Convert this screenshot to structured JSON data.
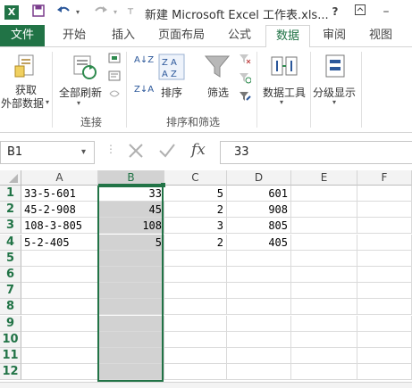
{
  "titlebar": {
    "title": "新建 Microsoft Excel 工作表.xls...",
    "help": "?",
    "app_icon": "X"
  },
  "tabs": [
    "文件",
    "开始",
    "插入",
    "页面布局",
    "公式",
    "数据",
    "审阅",
    "视图"
  ],
  "active_tab": "数据",
  "ribbon": {
    "get_external_1": "获取",
    "get_external_2": "外部数据",
    "refresh_all": "全部刷新",
    "group_connections": "连接",
    "sort": "排序",
    "filter": "筛选",
    "group_sort_filter": "排序和筛选",
    "data_tools": "数据工具",
    "outline": "分级显示",
    "sort_az": "A↓Z",
    "sort_za": "Z↓A"
  },
  "formula_bar": {
    "name_box": "B1",
    "fx": "fx",
    "value": "33"
  },
  "columns": [
    "A",
    "B",
    "C",
    "D",
    "E",
    "F"
  ],
  "selected_column": "B",
  "rows": [
    "1",
    "2",
    "3",
    "4",
    "5",
    "6",
    "7",
    "8",
    "9",
    "10",
    "11",
    "12"
  ],
  "cells": [
    [
      "33-5-601",
      "33",
      "5",
      "601"
    ],
    [
      "45-2-908",
      "45",
      "2",
      "908"
    ],
    [
      "108-3-805",
      "108",
      "3",
      "805"
    ],
    [
      "5-2-405",
      "5",
      "2",
      "405"
    ]
  ],
  "colors": {
    "accent": "#217346",
    "selection": "#d2d2d2"
  }
}
